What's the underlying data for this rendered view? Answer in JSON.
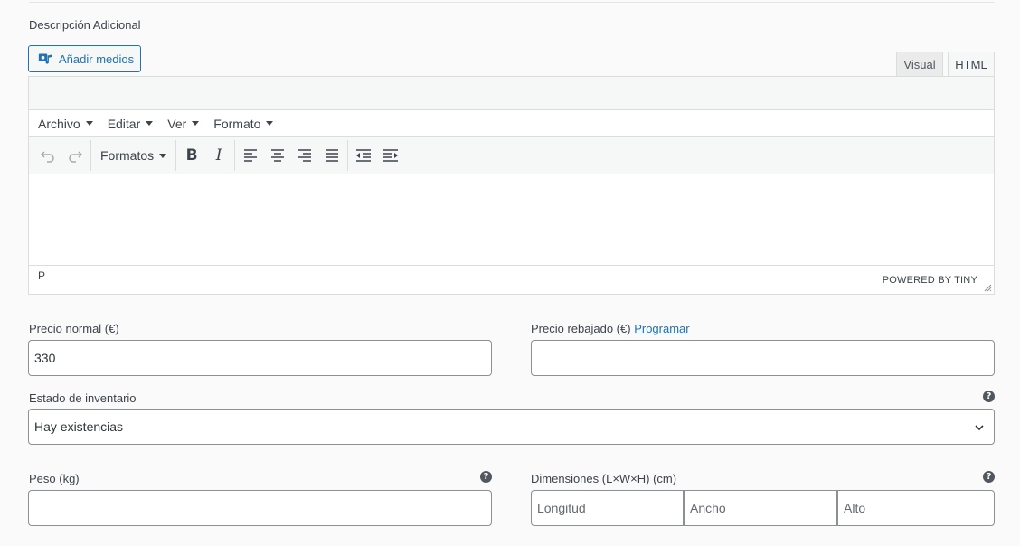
{
  "section": {
    "label": "Descripción Adicional"
  },
  "media_button": {
    "label": "Añadir medios"
  },
  "editor_tabs": {
    "visual": "Visual",
    "html": "HTML"
  },
  "menubar": {
    "items": [
      "Archivo",
      "Editar",
      "Ver",
      "Formato"
    ]
  },
  "toolbar": {
    "formats_label": "Formatos",
    "bold": "B",
    "italic": "I"
  },
  "statusbar": {
    "path": "P",
    "powered": "POWERED BY TINY"
  },
  "pricing": {
    "regular_label": "Precio normal (€)",
    "regular_value": "330",
    "sale_label": "Precio rebajado (€)",
    "sale_link": "Programar",
    "sale_value": ""
  },
  "inventory": {
    "label": "Estado de inventario",
    "selected": "Hay existencias"
  },
  "shipping": {
    "weight_label": "Peso (kg)",
    "weight_value": "",
    "dimensions_label": "Dimensiones (L×W×H) (cm)",
    "length_placeholder": "Longitud",
    "width_placeholder": "Ancho",
    "height_placeholder": "Alto"
  },
  "help_glyph": "?"
}
